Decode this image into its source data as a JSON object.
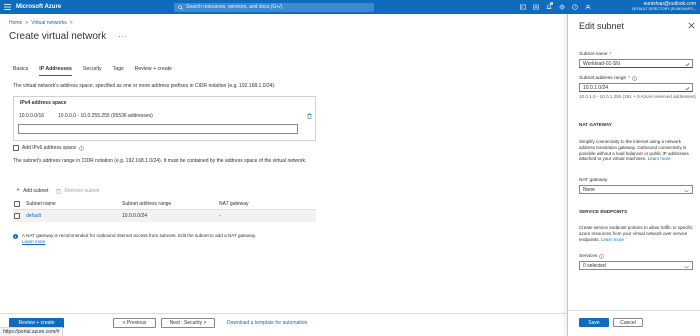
{
  "topbar": {
    "brand": "Microsoft Azure",
    "search_placeholder": "Search resources, services, and docs (G+/)",
    "notification_count": "1",
    "user_email": "eunishap@outlook.com",
    "user_directory": "DEFAULT DIRECTORY (EUNISHAPO...",
    "bar_color": "#0f6cbd"
  },
  "breadcrumb": {
    "home": "Home",
    "sep": ">",
    "virtual_networks": "Virtual networks",
    "sep2": ">"
  },
  "page": {
    "title": "Create virtual network",
    "more": "···"
  },
  "tabs": [
    "Basics",
    "IP Addresses",
    "Security",
    "Tags",
    "Review + create"
  ],
  "ip_addresses": {
    "description": "The virtual network's address space, specified as one or more address prefixes in CIDR notation (e.g. 192.168.1.0/24).",
    "ipv4_header": "IPv4 address space",
    "ipv4_cidr": "10.0.0.0/16",
    "ipv4_range": "10.0.0.0 - 10.0.255.255 (65536 addresses)",
    "ipv4_input_value": "",
    "add_ipv6_label": "Add IPv6 address space",
    "subnet_description": "The subnet's address range in CIDR notation (e.g. 192.168.1.0/24). It must be contained by the address space of the virtual network.",
    "add_subnet_label": "Add subnet",
    "remove_subnet_label": "Remove subnet"
  },
  "subnet_table": {
    "headers": [
      "Subnet name",
      "Subnet address range",
      "NAT gateway"
    ],
    "rows": [
      {
        "name": "default",
        "range": "10.0.0.0/24",
        "nat": "-"
      }
    ]
  },
  "nat_note": {
    "text": "A NAT gateway is recommended for outbound internet access from subnets. Edit the subnet to add a NAT gateway.",
    "link": "Learn more"
  },
  "footer": {
    "review_create": "Review + create",
    "previous": "< Previous",
    "next": "Next : Security >",
    "download": "Download a template for automation",
    "status_url": "https://portal.azure.com/#"
  },
  "panel": {
    "title": "Edit subnet",
    "subnet_name_label": "Subnet name",
    "subnet_name_value": "Workload-01-SN",
    "address_range_label": "Subnet address range",
    "address_range_value": "10.0.1.0/24",
    "address_range_hint": "10.0.1.0 - 10.0.1.255 (251 + 5 Azure reserved addresses)",
    "nat_section": "NAT GATEWAY",
    "nat_text": "Simplify connectivity to the internet using a network address translation gateway. Outbound connectivity is possible without a load balancer or public IP addresses attached to your virtual machines.",
    "nat_learn_more": "Learn more",
    "nat_gateway_label": "NAT gateway",
    "nat_gateway_value": "None",
    "se_section": "SERVICE ENDPOINTS",
    "se_text": "Create service endpoint policies to allow traffic to specific azure resources from your virtual network over service endpoints.",
    "se_learn_more": "Learn more",
    "services_label": "Services",
    "services_value": "0 selected",
    "save": "Save",
    "cancel": "Cancel",
    "required_mark": "*"
  }
}
